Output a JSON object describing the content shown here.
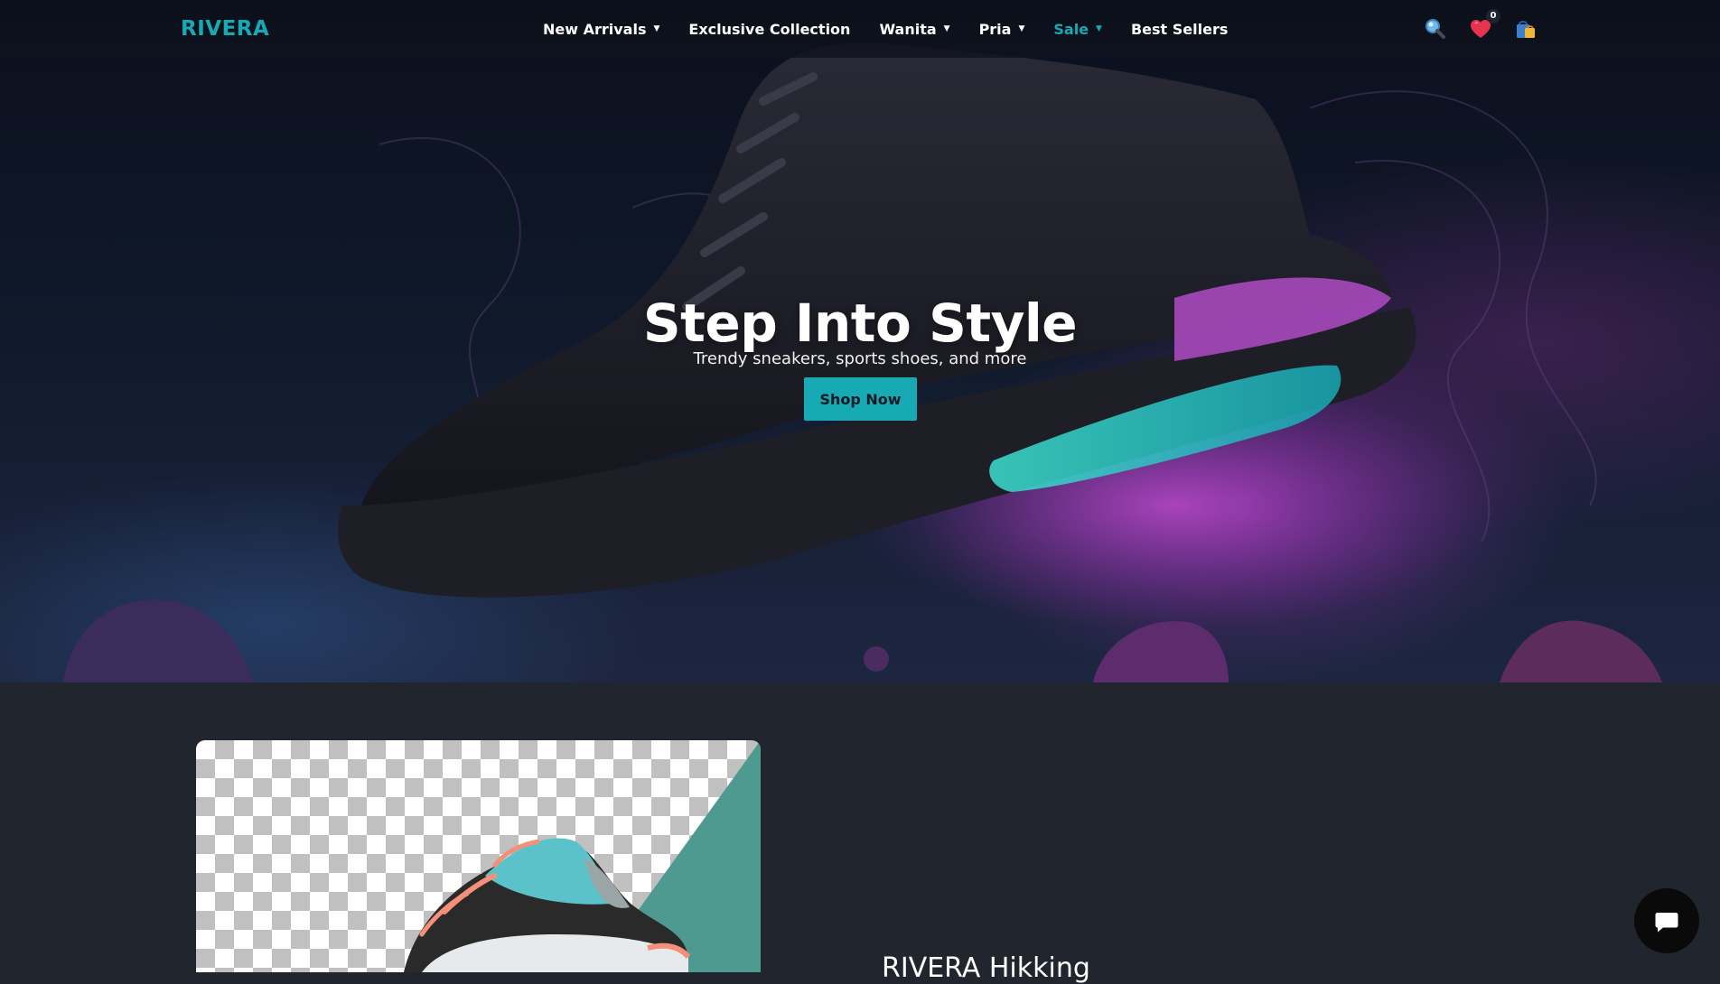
{
  "brand": {
    "name": "RIVERA",
    "color": "#17a9b4"
  },
  "nav": {
    "items": [
      {
        "label": "New Arrivals",
        "has_dropdown": true
      },
      {
        "label": "Exclusive Collection",
        "has_dropdown": false
      },
      {
        "label": "Wanita",
        "has_dropdown": true
      },
      {
        "label": "Pria",
        "has_dropdown": true
      },
      {
        "label": "Sale",
        "has_dropdown": true,
        "active": true
      },
      {
        "label": "Best Sellers",
        "has_dropdown": false
      }
    ],
    "caret": "▼",
    "icons": {
      "search": "search-icon",
      "wishlist": "heart-icon",
      "wishlist_count": "0",
      "cart": "shopping-bag-icon"
    }
  },
  "hero": {
    "title": "Step Into Style",
    "subtitle": "Trendy sneakers, sports shoes, and more",
    "cta_label": "Shop Now"
  },
  "featured": {
    "product_name": "RIVERA Hikking",
    "accent_color": "#4e9990"
  },
  "chat": {
    "icon": "chat-bubble-icon"
  }
}
